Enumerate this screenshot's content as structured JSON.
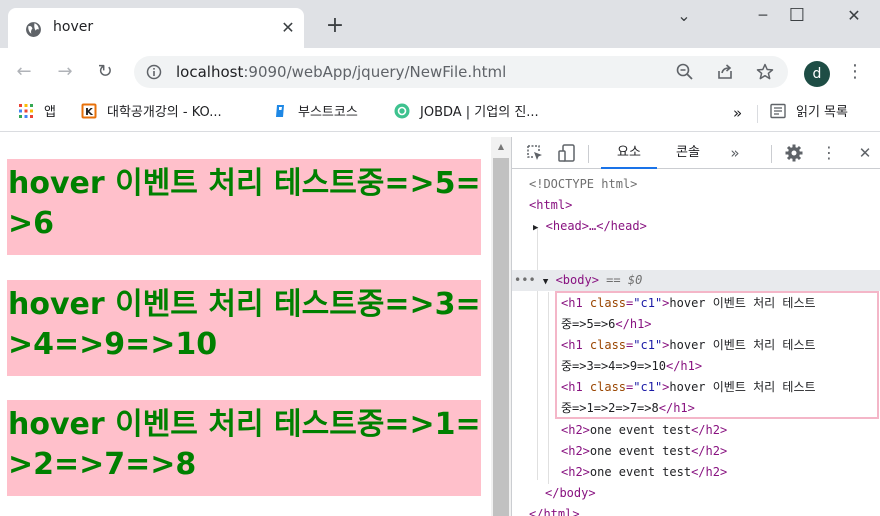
{
  "tab": {
    "title": "hover",
    "close": "✕"
  },
  "newtab": "+",
  "window": {
    "minimize": "─",
    "maximize": "☐",
    "close": "✕",
    "chevron": "⌄"
  },
  "toolbar": {
    "back": "←",
    "forward": "→",
    "reload": "↻",
    "url_host": "localhost",
    "url_rest": ":9090/webApp/jquery/NewFile.html",
    "avatar_letter": "d",
    "menu": "⋮"
  },
  "bookmarks": {
    "items": [
      {
        "label": "앱",
        "icon": "apps-grid-icon"
      },
      {
        "label": "대학공개강의 - KO...",
        "icon": "kocw-icon"
      },
      {
        "label": "부스트코스",
        "icon": "boostcourse-icon"
      },
      {
        "label": "JOBDA | 기업의 진...",
        "icon": "jobda-icon"
      }
    ],
    "overflow": "»",
    "reading_list": "읽기 목록"
  },
  "page": {
    "h1": [
      "hover 이벤트 처리 테스트중=>5=>6",
      "hover 이벤트 처리 테스트중=>3=>4=>9=>10",
      "hover 이벤트 처리 테스트중=>1=>2=>7=>8"
    ],
    "colors": {
      "h1_bg": "#ffc0cb",
      "h1_text": "#008000"
    }
  },
  "devtools": {
    "tabs": {
      "elements": "요소",
      "console": "콘솔",
      "more": "»"
    },
    "doctype": "<!DOCTYPE html>",
    "html_open": "<html>",
    "head": "<head>…</head>",
    "body_open": "<body>",
    "body_marker": "== $0",
    "ellipsis": "•••",
    "h1_class_attr": "class",
    "h1_class_val": "\"c1\"",
    "h1_lines": [
      [
        "hover 이벤트 처리 테스트",
        "중=>5=>6"
      ],
      [
        "hover 이벤트 처리 테스트",
        "중=>3=>4=>9=>10"
      ],
      [
        "hover 이벤트 처리 테스트",
        "중=>1=>2=>7=>8"
      ]
    ],
    "h2_text": "one event test",
    "body_close": "</body>",
    "html_close": "</html>"
  }
}
